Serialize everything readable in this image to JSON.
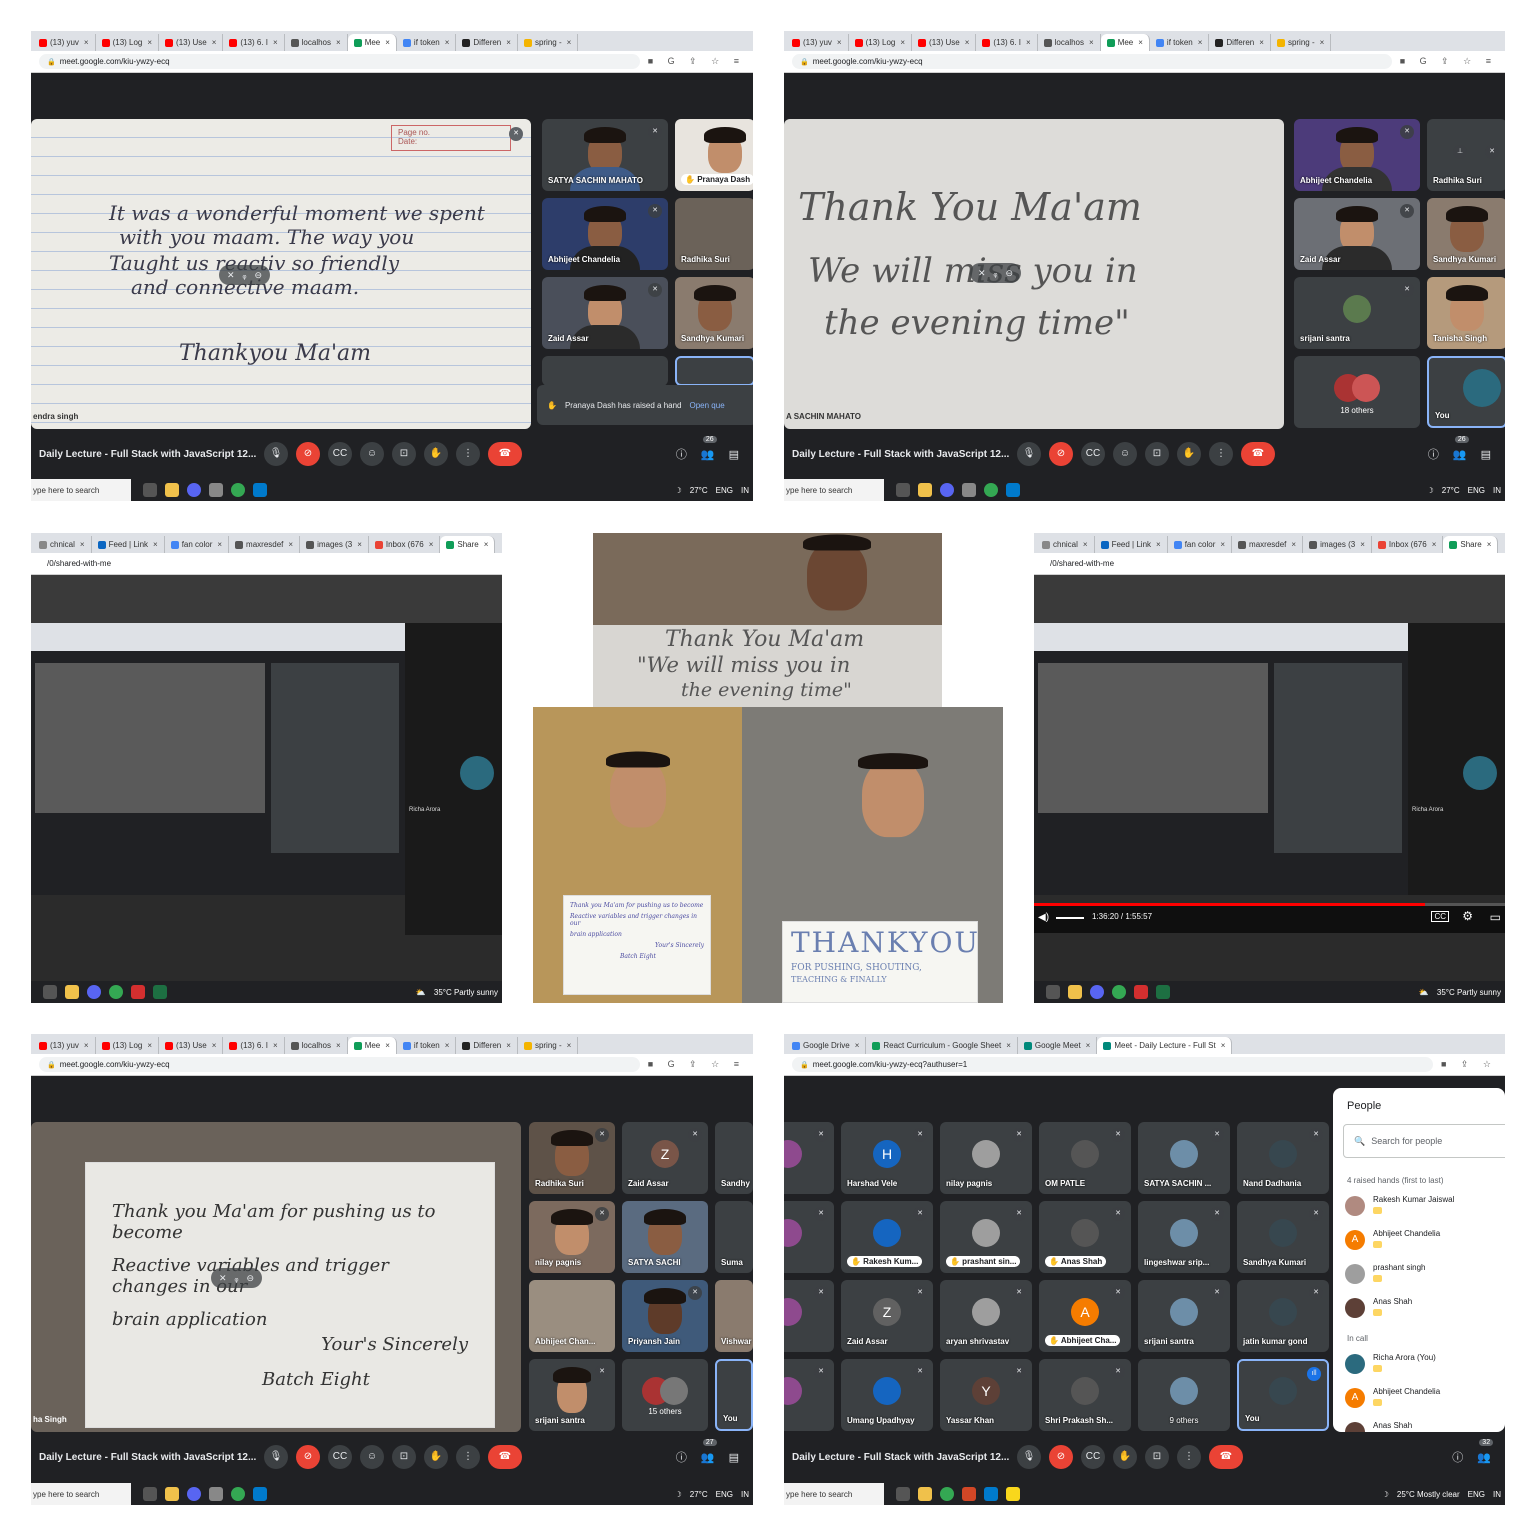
{
  "colors": {
    "meet_bg": "#202124",
    "tile_bg": "#3c4043",
    "red": "#ea4335",
    "blue": "#8ab4f8",
    "hand": "#fdd663"
  },
  "tabs_a": [
    "(13) yuv",
    "(13) Log",
    "(13) Use",
    "(13) 6. I",
    "localhos",
    "Mee",
    "if token",
    "Differen",
    "spring -"
  ],
  "tabs_d": [
    "Google Drive",
    "React Curriculum - Google Sheet",
    "Google Meet",
    "Meet - Daily Lecture - Full St"
  ],
  "tabs_drive": [
    "chnical",
    "Feed | Link",
    "fan color",
    "maxresdef",
    "images (3",
    "Inbox (676",
    "Share"
  ],
  "url_meet": "meet.google.com/kiu-ywzy-ecq",
  "url_meet_auth": "meet.google.com/kiu-ywzy-ecq?authuser=1",
  "url_drive": "/0/shared-with-me",
  "meeting_title": "Daily Lecture - Full Stack with JavaScript 12...",
  "taskbar": {
    "search": "ype here to search",
    "weather1": "27°C",
    "weather2": "35°C Partly sunny",
    "weather3": "25°C Mostly clear",
    "lang": "ENG",
    "region": "IN"
  },
  "p1": {
    "note_lines": [
      "It was a wonderful moment we spent",
      "with you maam. The way you",
      "Taught us reactiv so friendly",
      "and connective maam."
    ],
    "signoff": "Thankyou Ma'am",
    "page_no": "Page no.",
    "page_date": "Date:",
    "presenter": "endra singh",
    "participants": [
      "SATYA SACHIN MAHATO",
      "Pranaya Dash",
      "Abhijeet Chandelia",
      "Radhika Suri",
      "Zaid Assar",
      "Sandhya Kumari"
    ],
    "raised_hand": "Pranaya Dash has raised a hand",
    "open_queue": "Open que",
    "count": "26"
  },
  "p2": {
    "note_lines": [
      "Thank You Ma'am",
      "We will miss you in",
      "the evening time\""
    ],
    "presenter": "A SACHIN MAHATO",
    "participants": [
      "Abhijeet Chandelia",
      "Radhika Suri",
      "Zaid Assar",
      "Sandhya Kumari",
      "srijani santra",
      "Tanisha Singh"
    ],
    "others": "18 others",
    "you": "You",
    "count": "26"
  },
  "p3": {
    "presenter_name": "Richa Arora"
  },
  "p4": {
    "note_lines": [
      "Thank You Ma'am",
      "\"We will miss you in",
      "the evening time\""
    ],
    "letter_lines": [
      "Thank you Ma'am for pushing us to become",
      "Reactive variables and trigger changes in our",
      "brain application",
      "Your's Sincerely",
      "Batch Eight"
    ],
    "banner_main": "THANKYOU",
    "banner_sub": "FOR PUSHING, SHOUTING,",
    "banner_sub2": "TEACHING & FINALLY"
  },
  "p5": {
    "time": "1:36:20 / 1:55:57",
    "presenter_name": "Richa Arora"
  },
  "p6": {
    "letter_lines": [
      "Thank you Ma'am for pushing us to become",
      "Reactive variables and trigger changes in our",
      "brain application",
      "Your's Sincerely",
      "Batch Eight"
    ],
    "presenter": "ha Singh",
    "participants": [
      "Radhika Suri",
      "Zaid Assar",
      "Sandhy",
      "nilay pagnis",
      "SATYA SACHI",
      "Suma",
      "Abhijeet Chan...",
      "Priyansh Jain",
      "Vishwar",
      "srijani santra"
    ],
    "others": "15 others",
    "you": "You",
    "zaid_initial": "Z",
    "count": "27"
  },
  "p7": {
    "grid": [
      "Sharma",
      "Harshad Vele",
      "nilay pagnis",
      "OM PATLE",
      "SATYA SACHIN ...",
      "Nand Dadhania",
      "Singhal",
      "Rakesh Kum...",
      "prashant sin...",
      "Anas Shah",
      "lingeshwar srip...",
      "Sandhya Kumari",
      "wal",
      "Zaid Assar",
      "aryan shrivastav",
      "Abhijeet Cha...",
      "srijani santra",
      "jatin kumar gond",
      "uri",
      "Umang Upadhyay",
      "Yassar Khan",
      "Shri Prakash Sh...",
      "9 others",
      "You"
    ],
    "initials": {
      "harshad": "H",
      "zaid": "Z",
      "abhijeet": "A",
      "yassar": "Y"
    },
    "people_title": "People",
    "search_placeholder": "Search for people",
    "raised_header": "4 raised hands (first to last)",
    "raised": [
      "Rakesh Kumar Jaiswal",
      "Abhijeet Chandelia",
      "prashant singh",
      "Anas Shah"
    ],
    "in_call_header": "In call",
    "in_call": [
      "Richa Arora (You)",
      "Abhijeet Chandelia",
      "Anas Shah"
    ],
    "abhijeet_initial": "A",
    "count": "32"
  }
}
